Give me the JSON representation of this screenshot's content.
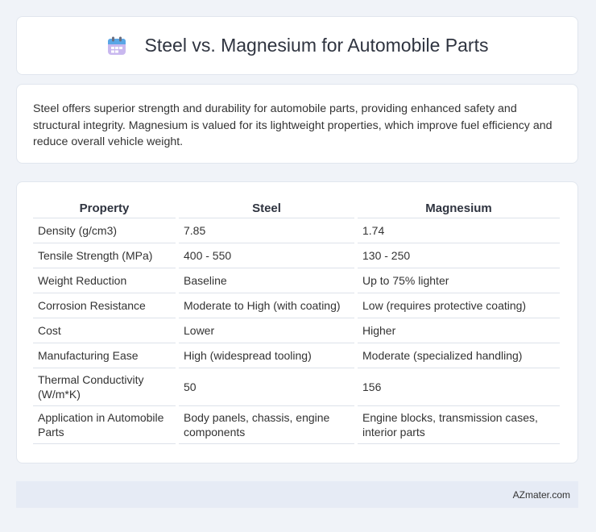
{
  "header": {
    "title": "Steel vs. Magnesium for Automobile Parts",
    "icon": "calendar-icon"
  },
  "intro": {
    "text": "Steel offers superior strength and durability for automobile parts, providing enhanced safety and structural integrity. Magnesium is valued for its lightweight properties, which improve fuel efficiency and reduce overall vehicle weight."
  },
  "table": {
    "headers": [
      "Property",
      "Steel",
      "Magnesium"
    ],
    "rows": [
      [
        "Density (g/cm3)",
        "7.85",
        "1.74"
      ],
      [
        "Tensile Strength (MPa)",
        "400 - 550",
        "130 - 250"
      ],
      [
        "Weight Reduction",
        "Baseline",
        "Up to 75% lighter"
      ],
      [
        "Corrosion Resistance",
        "Moderate to High (with coating)",
        "Low (requires protective coating)"
      ],
      [
        "Cost",
        "Lower",
        "Higher"
      ],
      [
        "Manufacturing Ease",
        "High (widespread tooling)",
        "Moderate (specialized handling)"
      ],
      [
        "Thermal Conductivity (W/m*K)",
        "50",
        "156"
      ],
      [
        "Application in Automobile Parts",
        "Body panels, chassis, engine components",
        "Engine blocks, transmission cases, interior parts"
      ]
    ]
  },
  "footer": {
    "brand": "AZmater.com"
  }
}
